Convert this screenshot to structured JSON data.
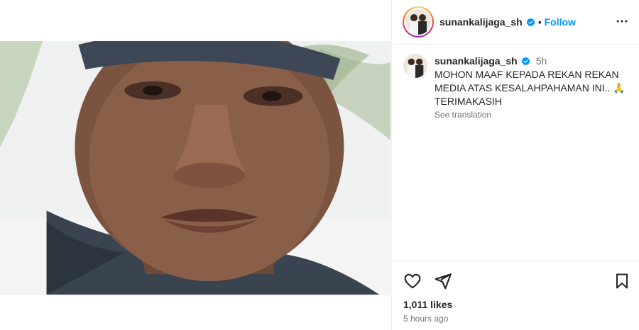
{
  "post": {
    "username": "sunankalijaga_sh",
    "follow_label": "Follow",
    "separator": "•",
    "caption_username": "sunankalijaga_sh",
    "caption_time": "5h",
    "caption_text_line1": "MOHON MAAF KEPADA REKAN REKAN",
    "caption_text_line2": "MEDIA ATAS KESALAHPAHAMAN INI..",
    "caption_emoji": "🙏",
    "caption_text_line3": "TERIMAKASIH",
    "see_translation": "See translation",
    "likes": "1,011 likes",
    "time_ago": "5 hours ago"
  },
  "media": {
    "carousel_count": 2,
    "carousel_active": 2,
    "muted": true
  },
  "icons": {
    "verified": "verified-badge-icon",
    "more": "more-options-icon",
    "like": "heart-icon",
    "share": "send-icon",
    "save": "bookmark-icon",
    "mute": "speaker-muted-icon"
  },
  "colors": {
    "accent": "#0095f6",
    "text": "#262626",
    "secondary": "#737373",
    "border": "#efefef"
  }
}
